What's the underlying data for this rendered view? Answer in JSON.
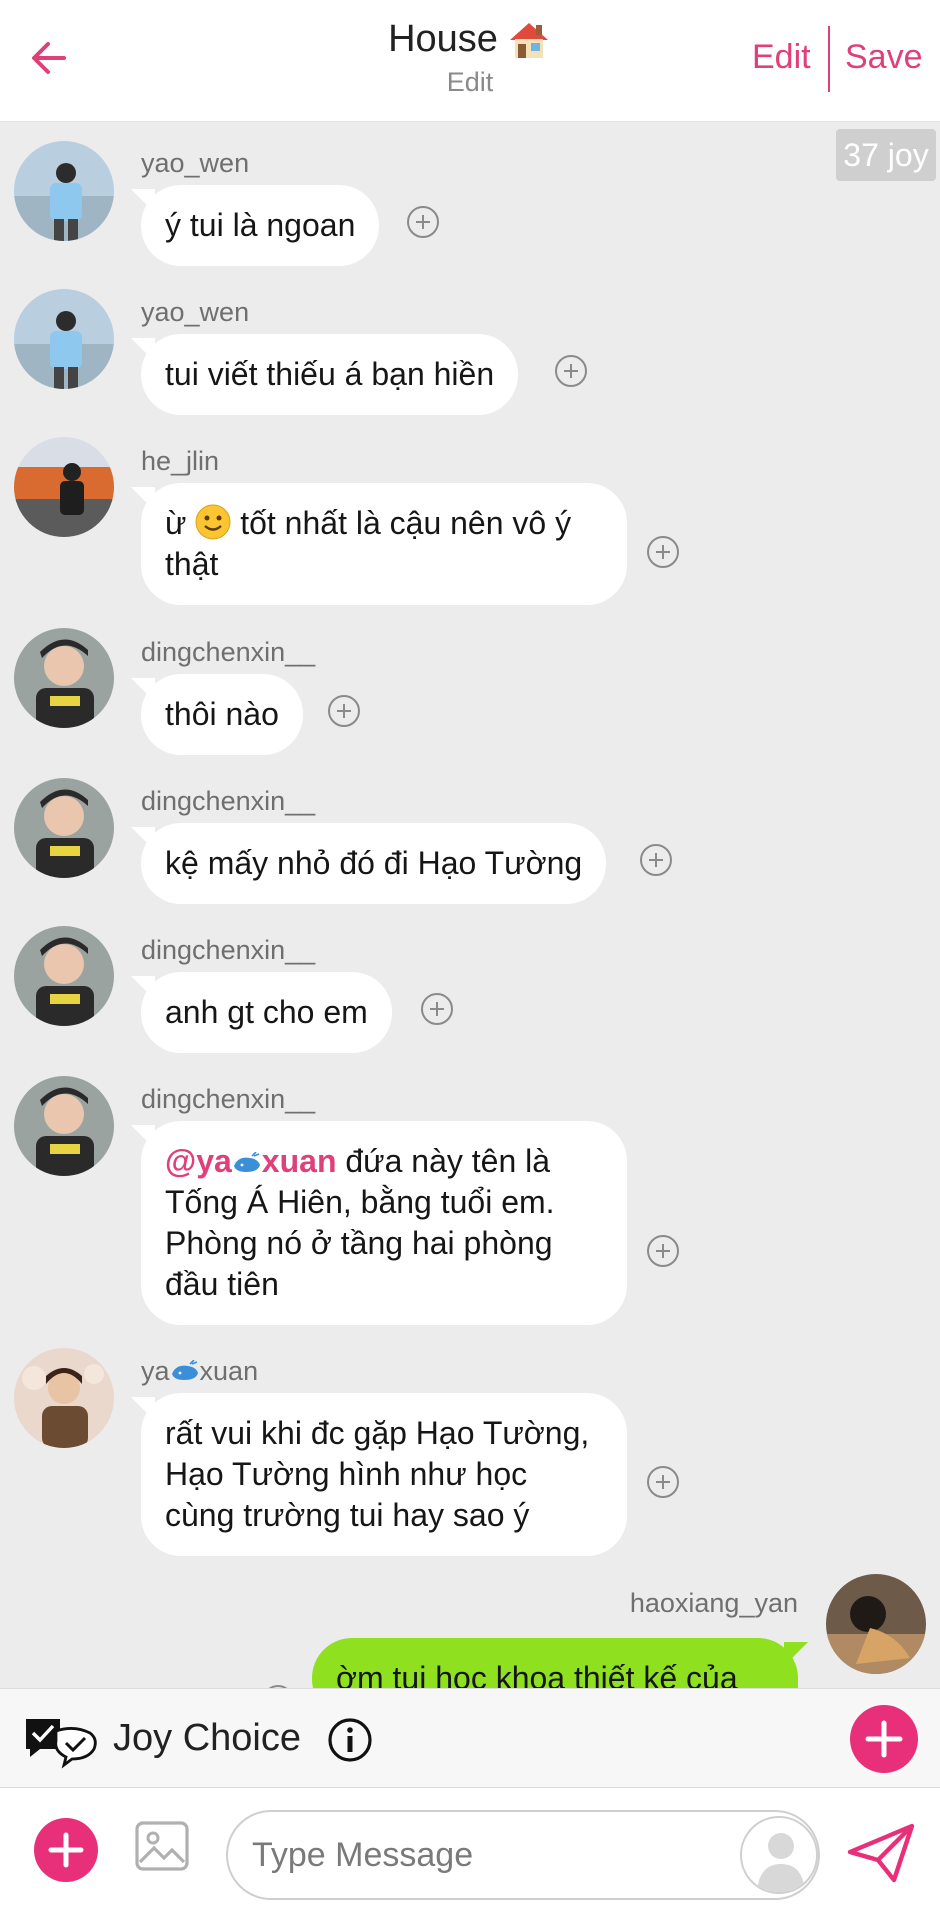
{
  "header": {
    "title": "House",
    "subtitle": "Edit",
    "edit_label": "Edit",
    "save_label": "Save",
    "accent_color": "#e0407a"
  },
  "badge": {
    "text": "37 joy"
  },
  "messages": [
    {
      "user": "yao_wen",
      "text": "ý tui là ngoan"
    },
    {
      "user": "yao_wen",
      "text": "tui viết thiếu á bạn hiền"
    },
    {
      "user": "he_jlin",
      "text_after_emoji": " tốt nhất là cậu nên vô ý thật",
      "text_before_emoji": "ừ "
    },
    {
      "user": "dingchenxin__",
      "text": "thôi nào"
    },
    {
      "user": "dingchenxin__",
      "text": "kệ mấy nhỏ đó đi Hạo Tường"
    },
    {
      "user": "dingchenxin__",
      "text": "anh gt cho em"
    },
    {
      "user": "dingchenxin__",
      "mention_a": "@ya",
      "mention_b": "xuan",
      "text": " đứa này tên là Tống Á Hiên, bằng tuổi em. Phòng nó ở tầng hai phòng đầu tiên"
    },
    {
      "user_a": "ya",
      "user_b": "xuan",
      "text": "rất vui khi đc gặp Hạo Tường, Hạo Tường hình như học cùng trường tui hay sao ý"
    },
    {
      "user": "haoxiang_yan",
      "text": "ờm tui học khoa thiết kế của",
      "own": true
    }
  ],
  "joy_choice": {
    "label": "Joy Choice"
  },
  "composer": {
    "placeholder": "Type Message"
  },
  "colors": {
    "own_bubble": "#8fe01e",
    "pink": "#e8307a",
    "background": "#ececec"
  }
}
